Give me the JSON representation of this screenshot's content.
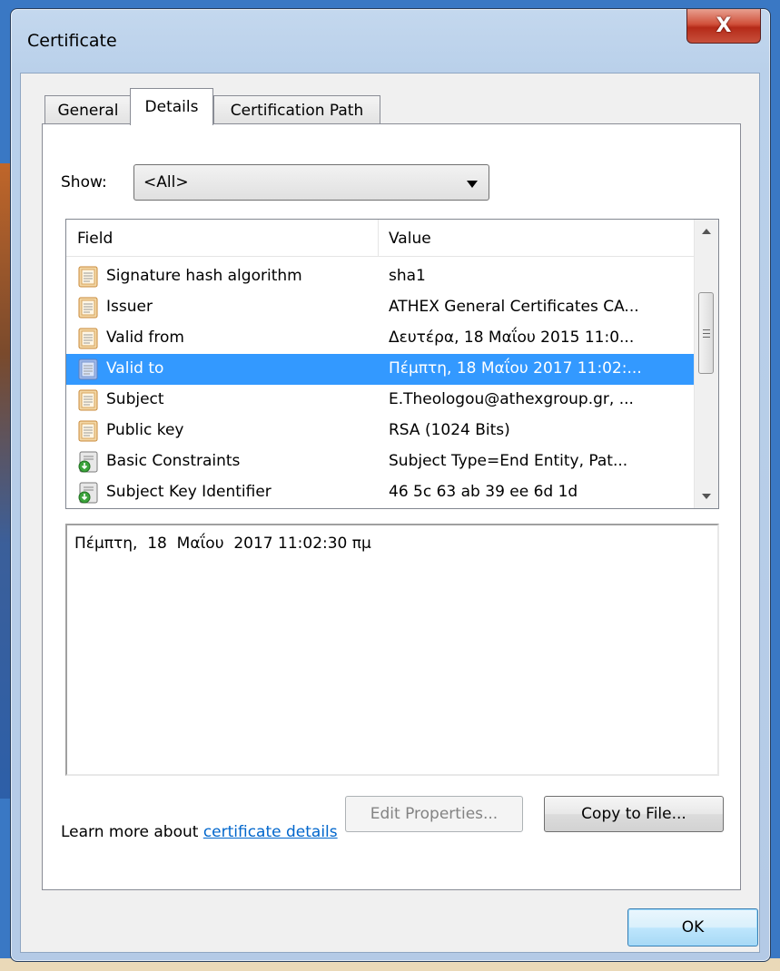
{
  "window": {
    "title": "Certificate",
    "close_label": "X"
  },
  "tabs": [
    {
      "label": "General"
    },
    {
      "label": "Details"
    },
    {
      "label": "Certification Path"
    }
  ],
  "show": {
    "label": "Show:",
    "value": "<All>"
  },
  "list": {
    "columns": {
      "field": "Field",
      "value": "Value"
    },
    "rows": [
      {
        "field": "Signature hash algorithm",
        "value": "sha1",
        "icon": "document-icon"
      },
      {
        "field": "Issuer",
        "value": "ATHEX General Certificates CA...",
        "icon": "document-icon"
      },
      {
        "field": "Valid from",
        "value": "Δευτέρα, 18 Μαΐου 2015 11:0...",
        "icon": "document-icon"
      },
      {
        "field": "Valid to",
        "value": "Πέμπτη, 18 Μαΐου 2017 11:02:...",
        "icon": "document-icon"
      },
      {
        "field": "Subject",
        "value": "E.Theologou@athexgroup.gr, ...",
        "icon": "document-icon"
      },
      {
        "field": "Public key",
        "value": "RSA (1024 Bits)",
        "icon": "document-icon"
      },
      {
        "field": "Basic Constraints",
        "value": "Subject Type=End Entity, Pat...",
        "icon": "extension-icon"
      },
      {
        "field": "Subject Key Identifier",
        "value": "46 5c 63 ab 39 ee 6d 1d",
        "icon": "extension-icon"
      }
    ],
    "selected_index": 3
  },
  "detail": {
    "text": "Πέμπτη,  18  Μαΐου  2017 11:02:30 πμ"
  },
  "buttons": {
    "edit_properties": "Edit Properties...",
    "copy_to_file": "Copy to File...",
    "ok": "OK"
  },
  "learn_more": {
    "prefix": "Learn more about ",
    "link": "certificate details"
  }
}
